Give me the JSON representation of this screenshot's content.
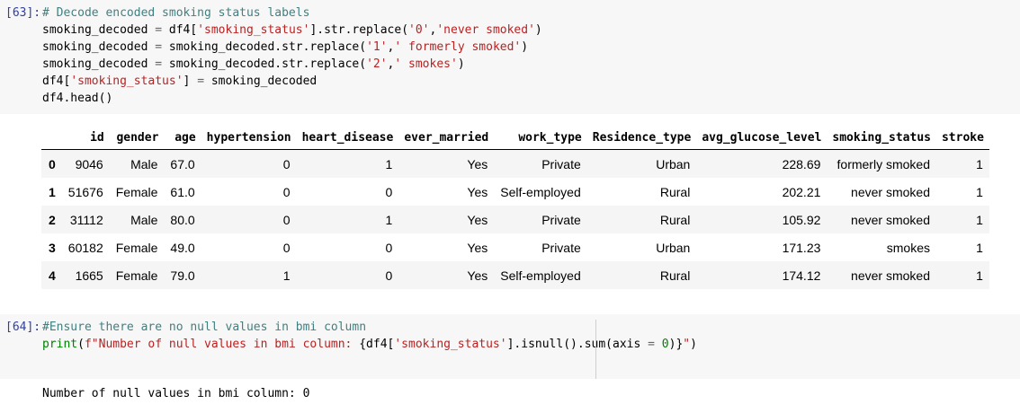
{
  "cell63": {
    "prompt": "[63]:",
    "lines": [
      [
        {
          "t": "# Decode encoded smoking status labels",
          "c": "c-comment"
        }
      ],
      [
        {
          "t": "smoking_decoded ",
          "c": "c-var"
        },
        {
          "t": "=",
          "c": "c-op"
        },
        {
          "t": " df4[",
          "c": "c-var"
        },
        {
          "t": "'smoking_status'",
          "c": "c-str"
        },
        {
          "t": "].",
          "c": "c-var"
        },
        {
          "t": "str",
          "c": "c-var"
        },
        {
          "t": ".replace(",
          "c": "c-var"
        },
        {
          "t": "'0'",
          "c": "c-str"
        },
        {
          "t": ",",
          "c": "c-var"
        },
        {
          "t": "'never smoked'",
          "c": "c-str"
        },
        {
          "t": ")",
          "c": "c-var"
        }
      ],
      [
        {
          "t": "smoking_decoded ",
          "c": "c-var"
        },
        {
          "t": "=",
          "c": "c-op"
        },
        {
          "t": " smoking_decoded.",
          "c": "c-var"
        },
        {
          "t": "str",
          "c": "c-var"
        },
        {
          "t": ".replace(",
          "c": "c-var"
        },
        {
          "t": "'1'",
          "c": "c-str"
        },
        {
          "t": ",",
          "c": "c-var"
        },
        {
          "t": "' formerly smoked'",
          "c": "c-str"
        },
        {
          "t": ")",
          "c": "c-var"
        }
      ],
      [
        {
          "t": "smoking_decoded ",
          "c": "c-var"
        },
        {
          "t": "=",
          "c": "c-op"
        },
        {
          "t": " smoking_decoded.",
          "c": "c-var"
        },
        {
          "t": "str",
          "c": "c-var"
        },
        {
          "t": ".replace(",
          "c": "c-var"
        },
        {
          "t": "'2'",
          "c": "c-str"
        },
        {
          "t": ",",
          "c": "c-var"
        },
        {
          "t": "' smokes'",
          "c": "c-str"
        },
        {
          "t": ")",
          "c": "c-var"
        }
      ],
      [
        {
          "t": "df4[",
          "c": "c-var"
        },
        {
          "t": "'smoking_status'",
          "c": "c-str"
        },
        {
          "t": "] ",
          "c": "c-var"
        },
        {
          "t": "=",
          "c": "c-op"
        },
        {
          "t": " smoking_decoded",
          "c": "c-var"
        }
      ],
      [
        {
          "t": "df4.head()",
          "c": "c-var"
        }
      ]
    ]
  },
  "dataframe": {
    "columns": [
      "",
      "id",
      "gender",
      "age",
      "hypertension",
      "heart_disease",
      "ever_married",
      "work_type",
      "Residence_type",
      "avg_glucose_level",
      "smoking_status",
      "stroke"
    ],
    "rows": [
      [
        "0",
        "9046",
        "Male",
        "67.0",
        "0",
        "1",
        "Yes",
        "Private",
        "Urban",
        "228.69",
        "formerly smoked",
        "1"
      ],
      [
        "1",
        "51676",
        "Female",
        "61.0",
        "0",
        "0",
        "Yes",
        "Self-employed",
        "Rural",
        "202.21",
        "never smoked",
        "1"
      ],
      [
        "2",
        "31112",
        "Male",
        "80.0",
        "0",
        "1",
        "Yes",
        "Private",
        "Rural",
        "105.92",
        "never smoked",
        "1"
      ],
      [
        "3",
        "60182",
        "Female",
        "49.0",
        "0",
        "0",
        "Yes",
        "Private",
        "Urban",
        "171.23",
        "smokes",
        "1"
      ],
      [
        "4",
        "1665",
        "Female",
        "79.0",
        "1",
        "0",
        "Yes",
        "Self-employed",
        "Rural",
        "174.12",
        "never smoked",
        "1"
      ]
    ]
  },
  "cell64": {
    "prompt": "[64]:",
    "lines": [
      [
        {
          "t": "#Ensure there are no null values in bmi column",
          "c": "c-comment"
        }
      ],
      [
        {
          "t": "print",
          "c": "c-print"
        },
        {
          "t": "(",
          "c": "c-var"
        },
        {
          "t": "f\"Number of null values in bmi column: ",
          "c": "c-str"
        },
        {
          "t": "{df4[",
          "c": "c-var"
        },
        {
          "t": "'smoking_status'",
          "c": "c-str"
        },
        {
          "t": "].isnull().",
          "c": "c-var"
        },
        {
          "t": "sum",
          "c": "c-var"
        },
        {
          "t": "(axis ",
          "c": "c-var"
        },
        {
          "t": "=",
          "c": "c-op"
        },
        {
          "t": " ",
          "c": "c-var"
        },
        {
          "t": "0",
          "c": "c-num"
        },
        {
          "t": ")}",
          "c": "c-var"
        },
        {
          "t": "\"",
          "c": "c-str"
        },
        {
          "t": ")",
          "c": "c-var"
        }
      ]
    ],
    "output": "Number of null values in bmi column: 0"
  }
}
